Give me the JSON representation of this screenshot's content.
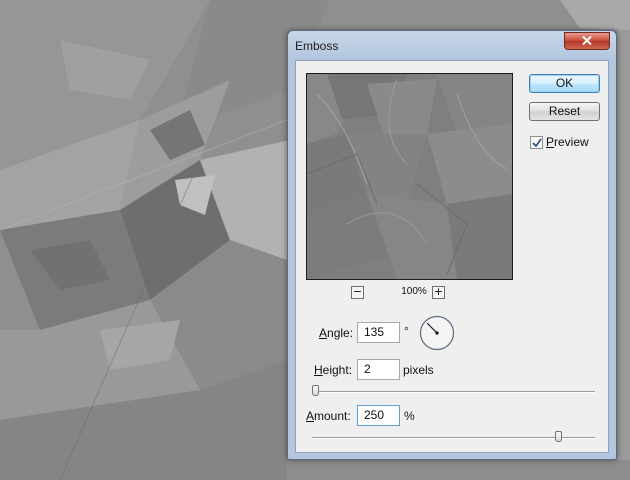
{
  "dialog": {
    "title": "Emboss",
    "close_icon": "close-icon",
    "buttons": {
      "ok": "OK",
      "reset": "Reset"
    },
    "preview_checkbox": {
      "label_key": "P",
      "label_rest": "review",
      "checked": true
    },
    "zoom": {
      "minus": "−",
      "plus": "+",
      "level": "100%"
    },
    "angle": {
      "label_key": "A",
      "label_rest": "ngle:",
      "value": "135",
      "unit": "°",
      "degrees": 135
    },
    "height": {
      "label_key": "H",
      "label_rest": "eight:",
      "value": "2",
      "unit": "pixels",
      "slider_fraction": 0.0
    },
    "amount": {
      "label_key": "A",
      "label_rest": "mount:",
      "value": "250",
      "unit": "%",
      "slider_fraction": 0.88
    }
  },
  "colors": {
    "accent": "#3c7fb1",
    "close": "#c74a37",
    "backdrop": "#8e8e8e"
  }
}
